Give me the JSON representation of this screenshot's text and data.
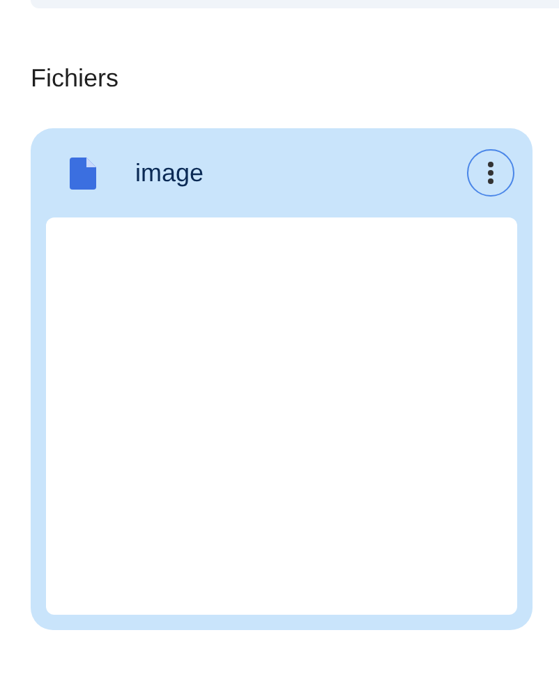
{
  "section_title": "Fichiers",
  "files": [
    {
      "name": "image"
    }
  ]
}
